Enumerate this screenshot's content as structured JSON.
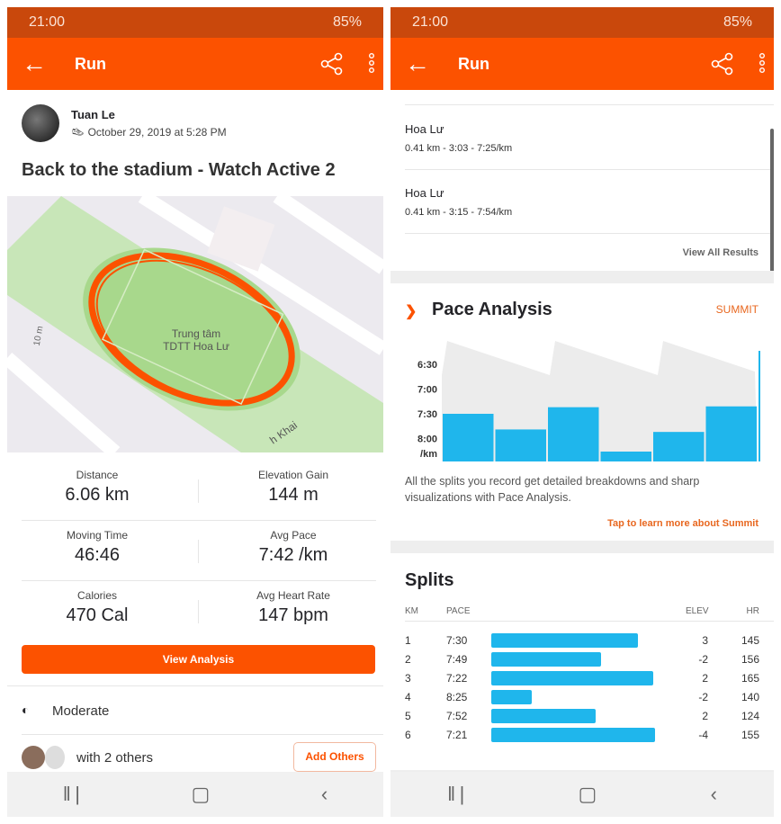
{
  "status": {
    "time": "21:00",
    "battery": "85%"
  },
  "appbar": {
    "title": "Run"
  },
  "activity": {
    "athlete": "Tuan Le",
    "date": "October 29, 2019 at 5:28 PM",
    "title": "Back to the stadium - Watch Active 2",
    "map": {
      "label_line1": "Trung tâm",
      "label_line2": "TDTT Hoa Lư",
      "street": "h Khai",
      "scale": "10 m"
    },
    "stats": [
      {
        "label": "Distance",
        "value": "6.06 km"
      },
      {
        "label": "Elevation Gain",
        "value": "144 m"
      },
      {
        "label": "Moving Time",
        "value": "46:46"
      },
      {
        "label": "Avg Pace",
        "value": "7:42 /km"
      },
      {
        "label": "Calories",
        "value": "470 Cal"
      },
      {
        "label": "Avg Heart Rate",
        "value": "147 bpm"
      }
    ],
    "view_analysis": "View Analysis",
    "effort": "Moderate",
    "with_others": "with 2 others",
    "add_others": "Add Others"
  },
  "segments": {
    "items": [
      {
        "name": "Hoa Lư",
        "detail": "0.41 km - 3:03 - 7:25/km"
      },
      {
        "name": "Hoa Lư",
        "detail": "0.41 km - 3:15 - 7:54/km"
      }
    ],
    "view_all": "View All Results"
  },
  "pace_analysis": {
    "title": "Pace Analysis",
    "badge": "SUMMIT",
    "description": "All the splits you record get detailed breakdowns and sharp visualizations with Pace Analysis.",
    "link": "Tap to learn more about Summit"
  },
  "chart_data": {
    "type": "bar",
    "categories": [
      "1",
      "2",
      "3",
      "4",
      "5",
      "6"
    ],
    "values": [
      "7:30",
      "7:49",
      "7:22",
      "8:25",
      "7:52",
      "7:21"
    ],
    "y_ticks": [
      "6:30",
      "7:00",
      "7:30",
      "8:00"
    ],
    "ylabel": "/km",
    "color": "#1fb6ec"
  },
  "splits": {
    "title": "Splits",
    "headers": {
      "km": "KM",
      "pace": "PACE",
      "elev": "ELEV",
      "hr": "HR"
    },
    "rows": [
      {
        "km": "1",
        "pace": "7:30",
        "elev": "3",
        "hr": "145"
      },
      {
        "km": "2",
        "pace": "7:49",
        "elev": "-2",
        "hr": "156"
      },
      {
        "km": "3",
        "pace": "7:22",
        "elev": "2",
        "hr": "165"
      },
      {
        "km": "4",
        "pace": "8:25",
        "elev": "-2",
        "hr": "140"
      },
      {
        "km": "5",
        "pace": "7:52",
        "elev": "2",
        "hr": "124"
      },
      {
        "km": "6",
        "pace": "7:21",
        "elev": "-4",
        "hr": "155"
      }
    ]
  },
  "colors": {
    "brand": "#fc5200",
    "status_bar": "#c9480c",
    "bar": "#1fb6ec"
  }
}
